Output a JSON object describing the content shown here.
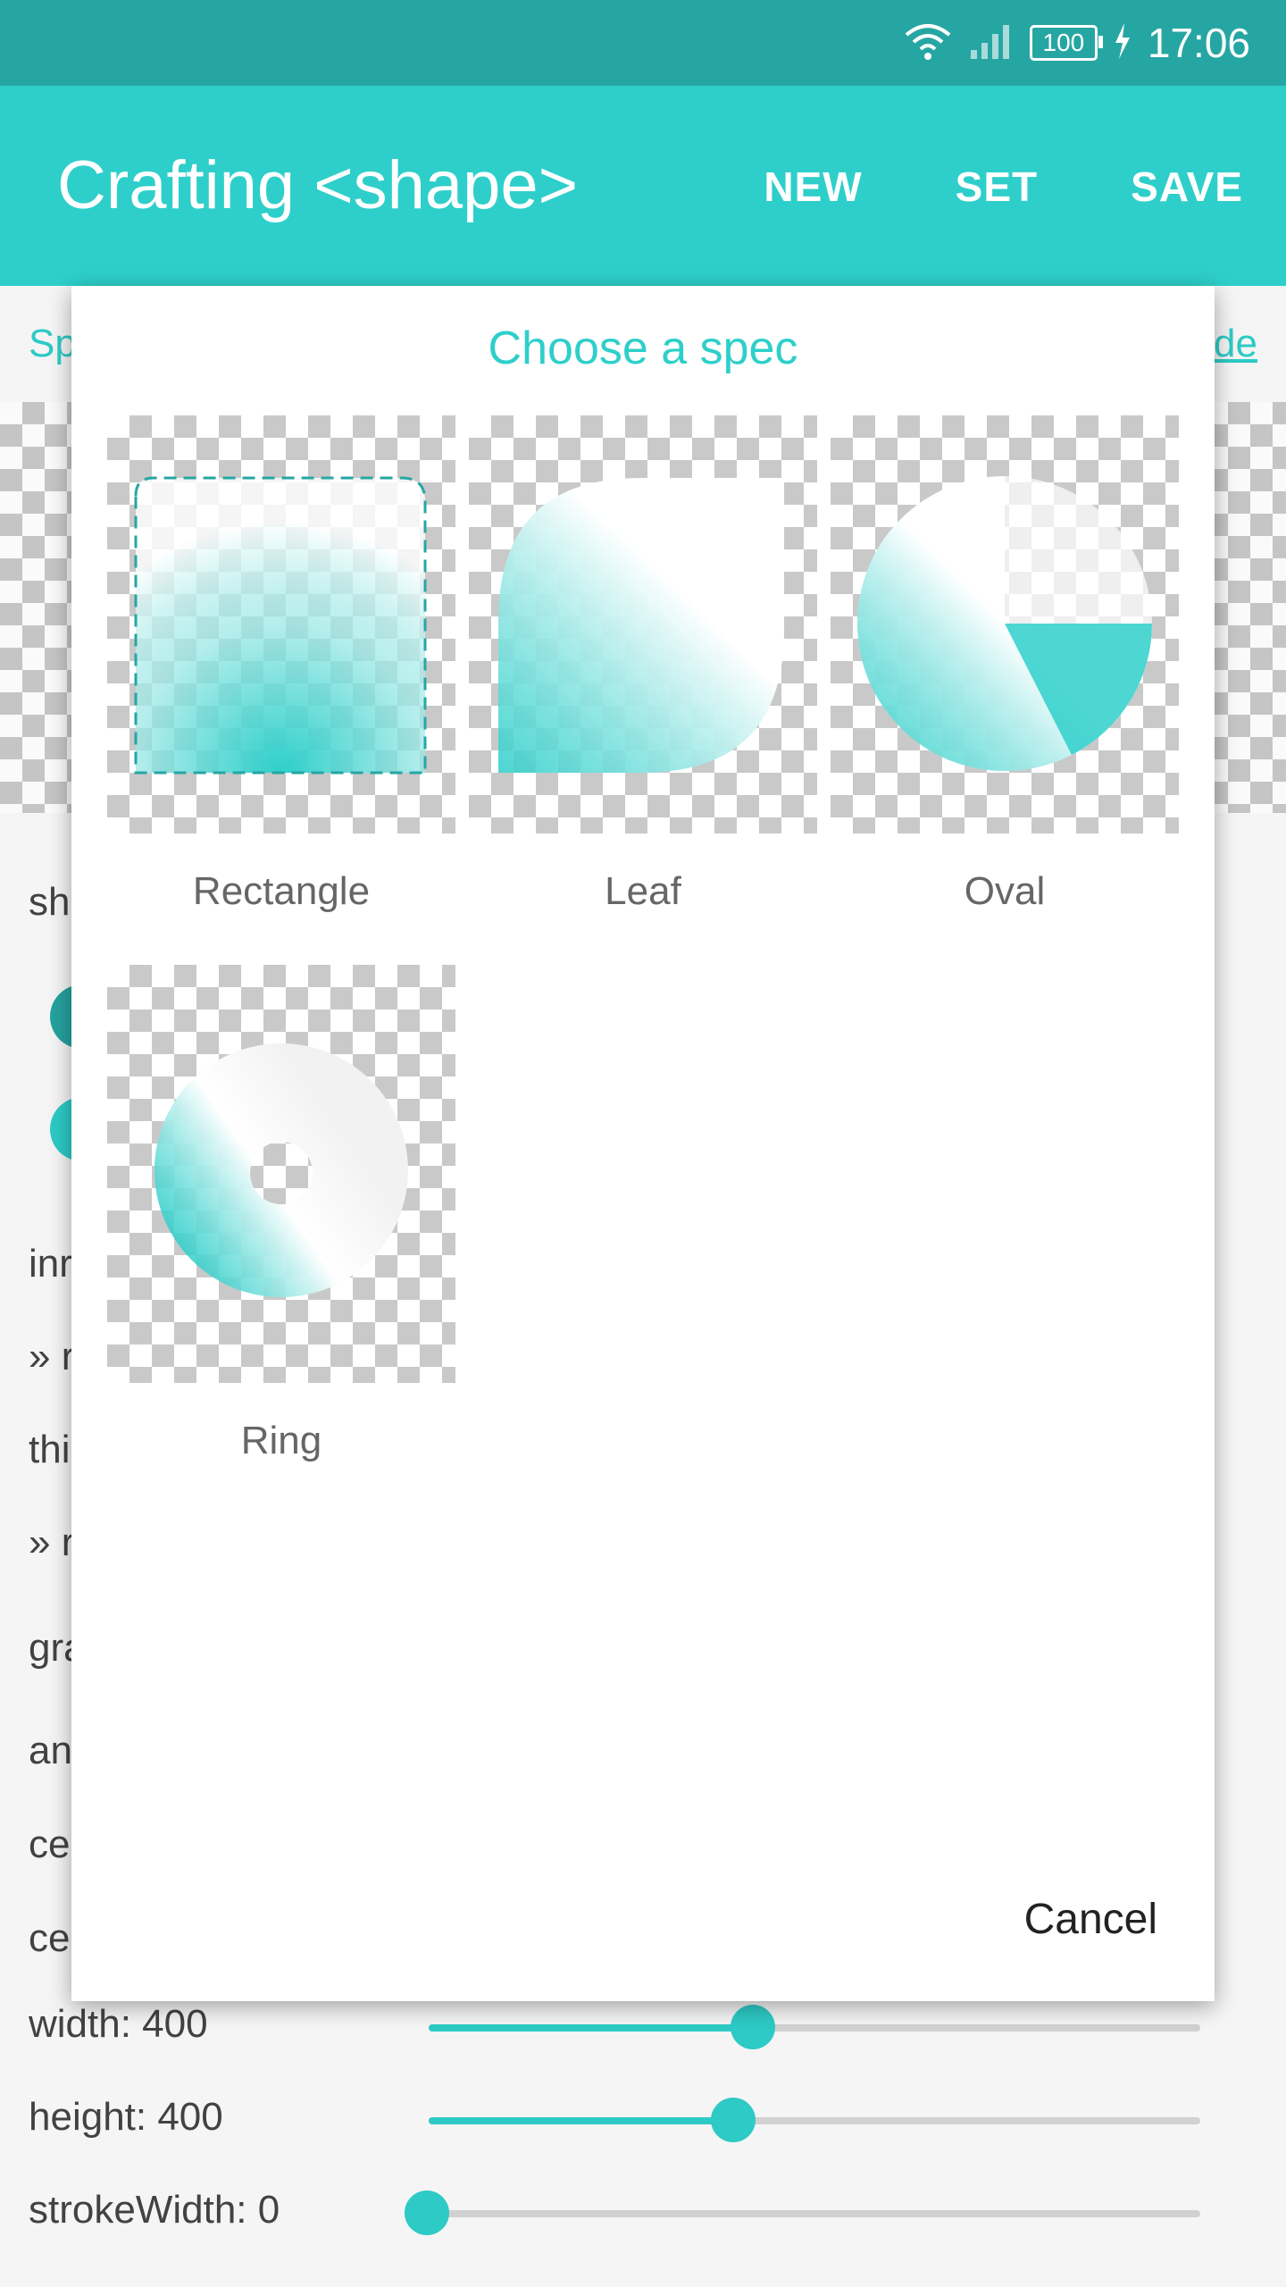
{
  "status_bar": {
    "time": "17:06",
    "battery": "100",
    "icons": [
      "wifi-icon",
      "signal-icon",
      "battery-icon",
      "charging-icon"
    ]
  },
  "app_bar": {
    "title": "Crafting <shape>",
    "actions": [
      "NEW",
      "SET",
      "SAVE"
    ]
  },
  "background": {
    "link_left": "Sp",
    "link_right": "de",
    "labels": [
      "sh",
      "inr",
      "» r",
      "thi",
      "» r",
      "gra",
      "an",
      "ce",
      "ce"
    ],
    "sliders": [
      {
        "label": "width: 400",
        "value": 0.42
      },
      {
        "label": "height: 400",
        "value": 0.395
      },
      {
        "label": "strokeWidth: 0",
        "value": 0.0
      }
    ]
  },
  "dialog": {
    "title": "Choose a spec",
    "options": [
      "Rectangle",
      "Leaf",
      "Oval",
      "Ring"
    ],
    "cancel": "Cancel"
  },
  "colors": {
    "status_bar": "#26a6a3",
    "app_bar": "#2ecfca",
    "accent": "#2ecfca"
  }
}
